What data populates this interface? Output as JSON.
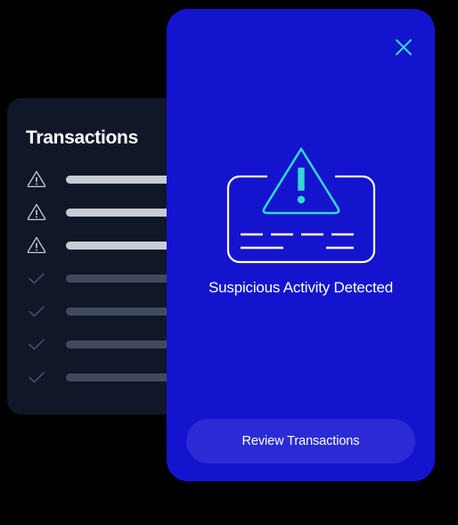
{
  "colors": {
    "page_background": "#000000",
    "card_background": "#101728",
    "modal_background": "#1414cf",
    "button_background": "#2b2bd6",
    "accent_cyan": "#35d6d0",
    "bar_alert": "#c9ccd4",
    "bar_done": "#414a5c",
    "icon_alert": "#c9ccd4",
    "icon_done": "#46506a",
    "text_primary": "#ffffff"
  },
  "transactions_card": {
    "title": "Transactions",
    "rows": [
      {
        "icon": "warning-triangle-icon",
        "state": "alert"
      },
      {
        "icon": "warning-triangle-icon",
        "state": "alert"
      },
      {
        "icon": "warning-triangle-icon",
        "state": "alert"
      },
      {
        "icon": "check-icon",
        "state": "done"
      },
      {
        "icon": "check-icon",
        "state": "done"
      },
      {
        "icon": "check-icon",
        "state": "done"
      },
      {
        "icon": "check-icon",
        "state": "done"
      }
    ]
  },
  "alert_modal": {
    "close_icon": "close-icon",
    "illustration": {
      "name": "credit-card-warning-illustration",
      "card_icon": "credit-card-icon",
      "warning_icon": "warning-triangle-icon",
      "card_number_dashes": 4,
      "card_detail_lines": 2
    },
    "headline": "Suspicious Activity Detected",
    "primary_button": {
      "label": "Review Transactions",
      "icon": null
    }
  }
}
